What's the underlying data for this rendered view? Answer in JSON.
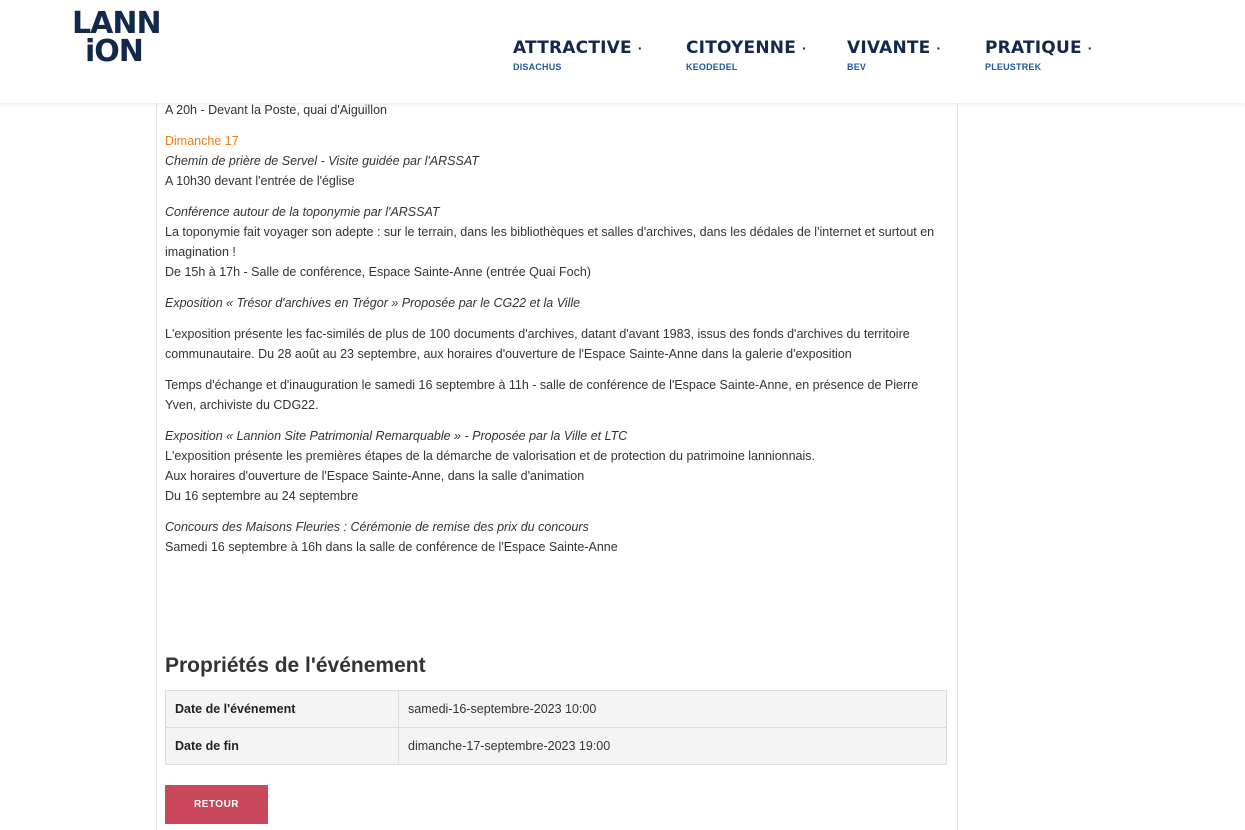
{
  "logo": {
    "line1": "LANN",
    "line2": "iON"
  },
  "nav": [
    {
      "label": "ATTRACTIVE",
      "sub": "DISACHUS",
      "dot": "·"
    },
    {
      "label": "CITOYENNE",
      "sub": "KEODEDEL",
      "dot": "·"
    },
    {
      "label": "VIVANTE",
      "sub": "BEV",
      "dot": "·"
    },
    {
      "label": "PRATIQUE",
      "sub": "PLEUSTREK",
      "dot": "·"
    }
  ],
  "content": {
    "intro_line": "A 20h - Devant la Poste, quai d'Aiguillon",
    "blocks": [
      {
        "date": "Dimanche 17",
        "title": "Chemin de prière de Servel - Visite guidée par l'ARSSAT",
        "text": "A 10h30 devant l'entrée de l'église"
      },
      {
        "title": "Conférence autour de la toponymie par l'ARSSAT",
        "text1": "La toponymie fait voyager son adepte : sur le terrain, dans les bibliothèques et salles d'archives, dans les dédales de l'internet et surtout en imagination !",
        "text2": "De 15h à 17h - Salle de conférence, Espace Sainte-Anne (entrée Quai Foch)"
      },
      {
        "title": "Exposition « Trésor d'archives en Trégor » Proposée par le CG22 et la Ville"
      },
      {
        "text": "L'exposition présente les fac-similés de plus de 100 documents d'archives, datant d'avant 1983, issus des fonds d'archives du territoire communautaire. Du 28 août au 23 septembre, aux horaires d'ouverture de l'Espace Sainte-Anne dans la galerie d'exposition"
      },
      {
        "text": "Temps d'échange et d'inauguration le samedi 16 septembre à 11h - salle de conférence de l'Espace Sainte-Anne, en présence de Pierre Yven, archiviste du CDG22."
      },
      {
        "title": "Exposition « Lannion Site Patrimonial Remarquable » - Proposée par la Ville et LTC",
        "text1": "L'exposition présente les premières étapes de la démarche de valorisation et de protection du patrimoine lannionnais.",
        "text2": "Aux horaires d'ouverture de l'Espace Sainte-Anne, dans la salle d'animation",
        "text3": "Du 16 septembre au 24 septembre"
      },
      {
        "title": "Concours des Maisons Fleuries : Cérémonie de remise des prix du concours",
        "text": "Samedi 16 septembre à 16h dans la salle de conférence de l'Espace Sainte-Anne"
      }
    ]
  },
  "properties": {
    "title": "Propriétés de l'événement",
    "rows": [
      {
        "key": "Date de l'événement",
        "value": "samedi-16-septembre-2023 10:00"
      },
      {
        "key": "Date de fin",
        "value": "dimanche-17-septembre-2023 19:00"
      }
    ]
  },
  "back_button": "RETOUR",
  "colors": {
    "navy": "#13294b",
    "orange": "#f07d1a",
    "button": "#c9485b"
  }
}
